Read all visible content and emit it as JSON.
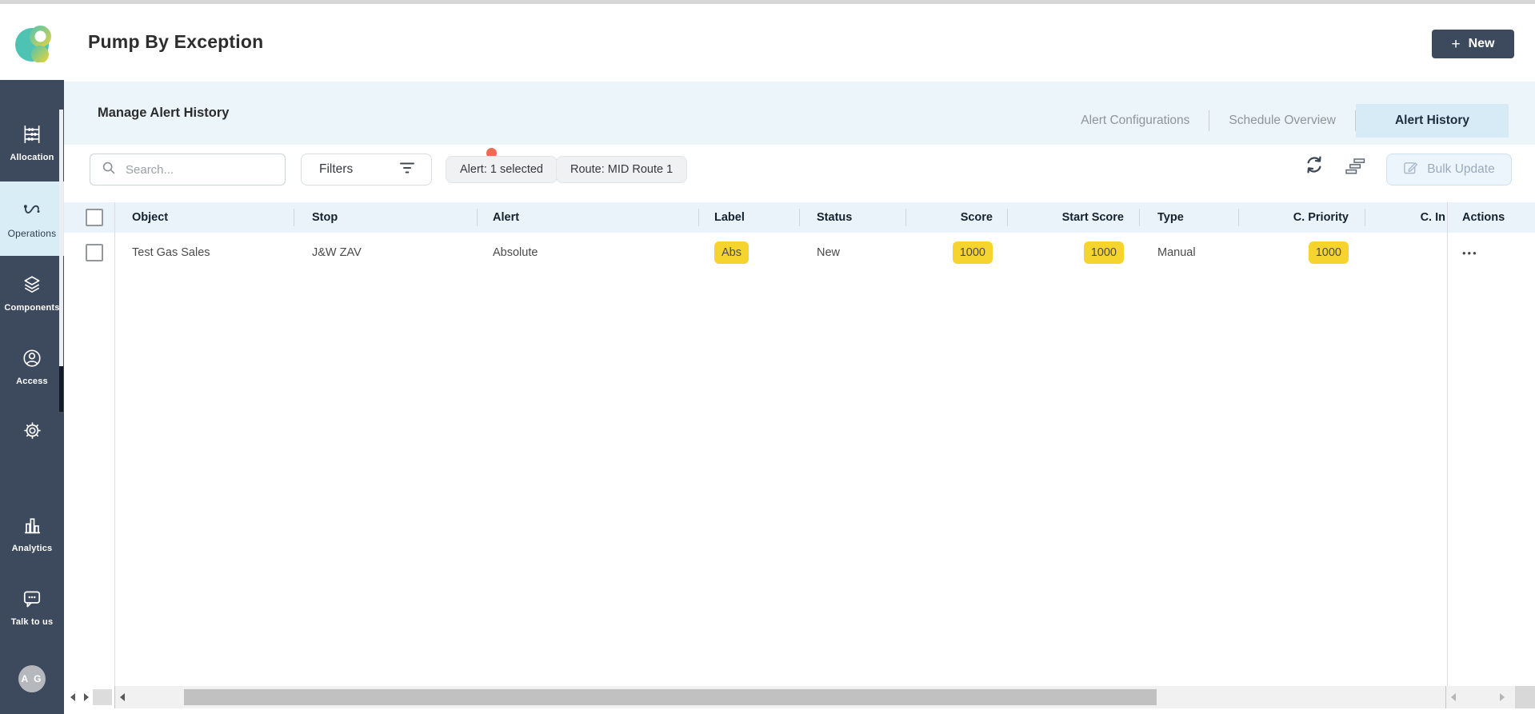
{
  "header": {
    "title": "Pump By Exception",
    "plus_icon": "+",
    "new_button": "New"
  },
  "sidebar": {
    "items": [
      {
        "label": "Allocation"
      },
      {
        "label": "Operations"
      },
      {
        "label": "Components"
      },
      {
        "label": "Access"
      },
      {
        "label": ""
      },
      {
        "label": "Analytics"
      },
      {
        "label": "Talk to us"
      }
    ],
    "avatar_initials": "A G"
  },
  "banner": {
    "title": "Manage Alert History",
    "tabs": [
      {
        "label": "Alert Configurations"
      },
      {
        "label": "Schedule Overview"
      },
      {
        "label": "Alert History"
      }
    ]
  },
  "toolbar": {
    "search_placeholder": "Search...",
    "filters_label": "Filters",
    "chips": [
      {
        "label": "Alert: 1 selected"
      },
      {
        "label": "Route: MID Route 1"
      }
    ],
    "bulk_update_label": "Bulk Update"
  },
  "table": {
    "columns": [
      {
        "label": "Object"
      },
      {
        "label": "Stop"
      },
      {
        "label": "Alert"
      },
      {
        "label": "Label"
      },
      {
        "label": "Status"
      },
      {
        "label": "Score"
      },
      {
        "label": "Start Score"
      },
      {
        "label": "Type"
      },
      {
        "label": "C. Priority"
      },
      {
        "label": "C. In"
      },
      {
        "label": "Actions"
      }
    ],
    "rows": [
      {
        "object": "Test Gas Sales",
        "stop": "J&W ZAV",
        "alert": "Absolute",
        "label": "Abs",
        "status": "New",
        "score": "1000",
        "start_score": "1000",
        "type": "Manual",
        "c_priority": "1000",
        "actions_icon": "•••"
      }
    ]
  },
  "colors": {
    "sidebar_navy": "#3d4a5e",
    "active_item_blue": "#d9edf7",
    "banner_blue": "#ebf5fa",
    "table_header_blue": "#e9f3f9",
    "badge_yellow": "#f6d430",
    "alert_dot_orange": "#ee6b4f",
    "brand_teal": "#4ec3b4",
    "brand_yellow": "#e6d23f"
  }
}
